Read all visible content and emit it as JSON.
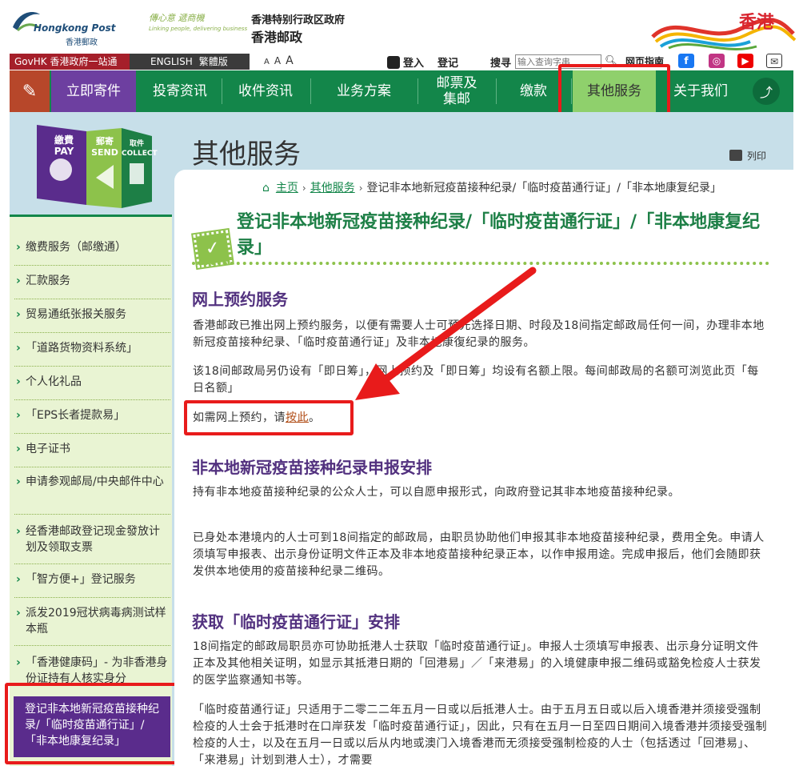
{
  "header": {
    "logo_en": "Hongkong Post",
    "logo_zh": "香港郵政",
    "slogan_zh": "傳心意 遞商機",
    "slogan_en": "Linking people, delivering business",
    "gov_line1": "香港特别行政区政府",
    "gov_line2": "香港邮政",
    "brand": "香港"
  },
  "utility": {
    "govhk": "GovHK 香港政府一站通",
    "english": "ENGLISH",
    "traditional": "繁體版",
    "font_sizes": [
      "A",
      "A",
      "A"
    ],
    "login": "登入",
    "register": "登记",
    "search_label": "搜寻",
    "search_placeholder": "输入查询字串",
    "web_guide": "网页指南"
  },
  "nav": {
    "items": [
      {
        "label": "立即寄件"
      },
      {
        "label": "投寄资讯"
      },
      {
        "label": "收件资讯"
      },
      {
        "label": "业务方案"
      },
      {
        "label": "邮票及集邮"
      },
      {
        "label": "缴款"
      },
      {
        "label": "其他服务"
      },
      {
        "label": "关于我们"
      }
    ]
  },
  "banner": {
    "pay": "繳費 PAY",
    "send": "郵寄 SEND",
    "collect": "取件 COLLECT"
  },
  "sidebar": {
    "items": [
      "缴费服务（邮缴通）",
      "汇款服务",
      "贸易通纸张报关服务",
      "「道路货物资料系统」",
      "个人化礼品",
      "「EPS长者提款易」",
      "电子证书",
      "申请参观邮局/中央邮件中心",
      "经香港邮政登记现金發放计划及领取支票",
      "「智方便+」登记服务",
      "派发2019冠状病毒病测试样本瓶",
      "「香港健康码」- 为非香港身份证持有人核实身分"
    ],
    "active": "登记非本地新冠疫苗接种纪录/「临时疫苗通行证」/「非本地康复纪录」"
  },
  "page": {
    "title": "其他服务",
    "print": "列印",
    "breadcrumb": {
      "home": "主页",
      "parent": "其他服务",
      "current": "登记非本地新冠疫苗接种纪录/「临时疫苗通行证」/「非本地康复纪录」"
    },
    "article_title": "登记非本地新冠疫苗接种纪录/「临时疫苗通行证」/「非本地康复纪录」",
    "sections": {
      "s1_title": "网上预约服务",
      "s1_p1": "香港邮政已推出网上预约服务，以便有需要人士可预先选择日期、时段及18间指定邮政局任何一间，办理非本地新冠疫苗接种纪录、「临时疫苗通行证」及非本地康復纪录的服务。",
      "s1_p2": "该18间邮政局另仍设有「即日筹」，网上预约及「即日筹」均设有名额上限。每间邮政局的名额可浏览此页「每日名额」",
      "s1_p3_pre": "如需网上预约，请",
      "s1_p3_link": "按此",
      "s1_p3_post": "。",
      "s2_title": "非本地新冠疫苗接种纪录申报安排",
      "s2_p1": "持有非本地疫苗接种纪录的公众人士，可以自愿申报形式，向政府登记其非本地疫苗接种纪录。",
      "s2_p2": "已身处本港境内的人士可到18间指定的邮政局，由职员协助他们申报其非本地疫苗接种纪录，费用全免。申请人须填写申报表、出示身份证明文件正本及非本地疫苗接种纪录正本，以作申报用途。完成申报后，他们会随即获发供本地使用的疫苗接种纪录二维码。",
      "s3_title": "获取「临时疫苗通行证」安排",
      "s3_p1": "18间指定的邮政局职员亦可协助抵港人士获取「临时疫苗通行证」。申报人士须填写申报表、出示身分证明文件正本及其他相关证明，如显示其抵港日期的「回港易」／「来港易」的入境健康申报二维码或豁免检疫人士获发的医学监察通知书等。",
      "s3_p2": "「临时疫苗通行证」只适用于二零二二年五月一日或以后抵港人士。由于五月五日或以后入境香港并须接受强制检疫的人士会于抵港时在口岸获发「临时疫苗通行证」，因此，只有在五月一日至四日期间入境香港并须接受强制检疫的人士，以及在五月一日或以后从内地或澳门入境香港而无须接受强制检疫的人士（包括透过「回港易」、「来港易」计划到港人士），才需要"
    }
  },
  "colors": {
    "nav_green": "#13864a",
    "active_purple": "#5a2c8c",
    "title_green": "#1d7f46",
    "section_purple": "#52317f",
    "highlight_red": "#e81b1b"
  },
  "icons": [
    "edit-icon",
    "share-icon",
    "home-icon",
    "print-icon",
    "search-icon",
    "user-icon",
    "facebook-icon",
    "instagram-icon",
    "youtube-icon",
    "mail-icon",
    "stamp-icon"
  ]
}
